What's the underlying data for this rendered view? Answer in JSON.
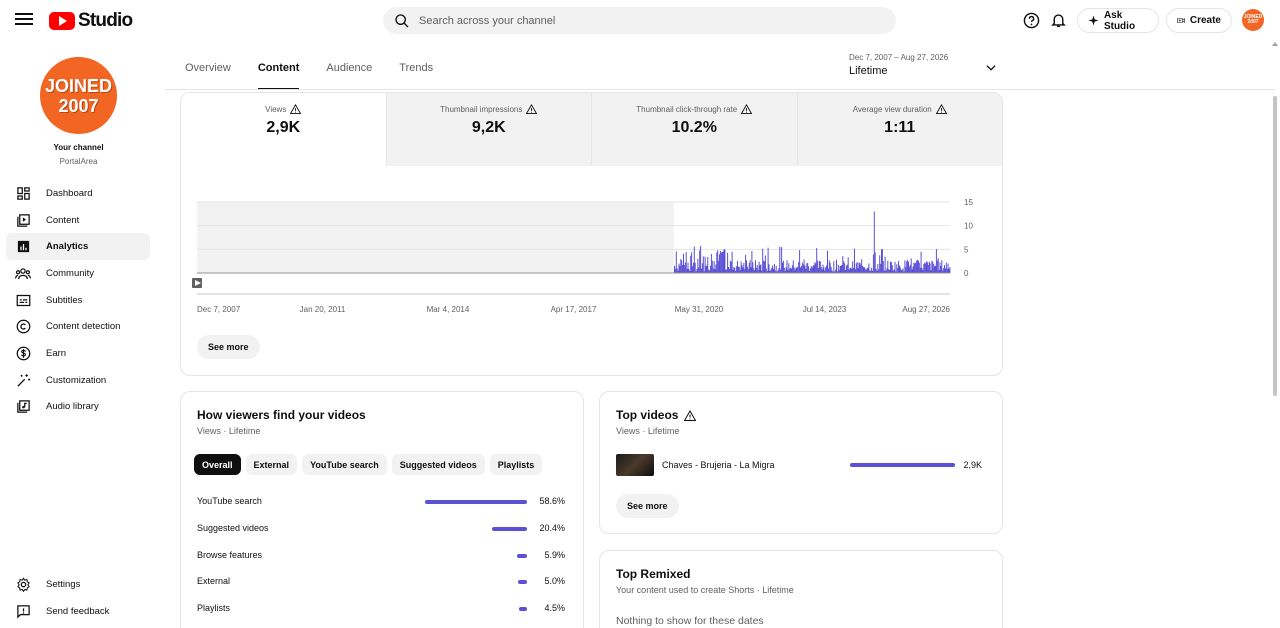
{
  "header": {
    "logo_text": "Studio",
    "search_placeholder": "Search across your channel",
    "ask_label": "Ask Studio",
    "create_label": "Create",
    "avatar_text_1": "JOINED",
    "avatar_text_2": "2007"
  },
  "sidebar": {
    "avatar_line1": "JOINED",
    "avatar_line2": "2007",
    "channel_label": "Your channel",
    "channel_name": "PortalArea",
    "items": [
      {
        "label": "Dashboard",
        "icon": "dashboard-icon"
      },
      {
        "label": "Content",
        "icon": "content-icon"
      },
      {
        "label": "Analytics",
        "icon": "analytics-icon",
        "active": true
      },
      {
        "label": "Community",
        "icon": "community-icon"
      },
      {
        "label": "Subtitles",
        "icon": "subtitles-icon"
      },
      {
        "label": "Content detection",
        "icon": "copyright-icon"
      },
      {
        "label": "Earn",
        "icon": "dollar-icon"
      },
      {
        "label": "Customization",
        "icon": "wand-icon"
      },
      {
        "label": "Audio library",
        "icon": "audio-library-icon"
      }
    ],
    "bottom": [
      {
        "label": "Settings",
        "icon": "gear-icon"
      },
      {
        "label": "Send feedback",
        "icon": "feedback-icon"
      }
    ]
  },
  "tabs": [
    "Overview",
    "Content",
    "Audience",
    "Trends"
  ],
  "active_tab": "Content",
  "date_range": {
    "dates": "Dec 7, 2007 – Aug 27, 2026",
    "label": "Lifetime"
  },
  "metrics": [
    {
      "label": "Views",
      "value": "2,9K"
    },
    {
      "label": "Thumbnail impressions",
      "value": "9,2K"
    },
    {
      "label": "Thumbnail click-through rate",
      "value": "10.2%"
    },
    {
      "label": "Average view duration",
      "value": "1:11"
    }
  ],
  "chart_data": {
    "type": "bar",
    "title": "",
    "xlabel": "",
    "ylabel": "",
    "x_ticks": [
      "Dec 7, 2007",
      "Jan 20, 2011",
      "Mar 4, 2014",
      "Apr 17, 2017",
      "May 31, 2020",
      "Jul 14, 2023",
      "Aug 27, 2026"
    ],
    "y_ticks": [
      15,
      10,
      5,
      0
    ],
    "ylim": [
      0,
      15
    ],
    "series": [
      {
        "x_range": [
          "Oct 2019",
          "Aug 27, 2026"
        ],
        "peak_date": "Oct 2024",
        "peak_value": 13,
        "typical_range": [
          0,
          5
        ]
      }
    ],
    "grid": true,
    "shaded_region": [
      "Dec 7, 2007",
      "Oct 2019"
    ],
    "color": "#5b50d6"
  },
  "main_see_more": "See more",
  "traffic": {
    "title": "How viewers find your videos",
    "subtitle": "Views · Lifetime",
    "chips": [
      "Overall",
      "External",
      "YouTube search",
      "Suggested videos",
      "Playlists"
    ],
    "rows": [
      {
        "label": "YouTube search",
        "value": "58.6%",
        "pct": 58.6
      },
      {
        "label": "Suggested videos",
        "value": "20.4%",
        "pct": 20.4
      },
      {
        "label": "Browse features",
        "value": "5.9%",
        "pct": 5.9
      },
      {
        "label": "External",
        "value": "5.0%",
        "pct": 5.0
      },
      {
        "label": "Playlists",
        "value": "4.5%",
        "pct": 4.5
      }
    ]
  },
  "top_videos": {
    "title": "Top videos",
    "subtitle": "Views · Lifetime",
    "videos": [
      {
        "title": "Chaves - Brujeria - La Migra",
        "value": "2,9K"
      }
    ],
    "see_more": "See more"
  },
  "top_remixed": {
    "title": "Top Remixed",
    "subtitle": "Your content used to create Shorts · Lifetime",
    "empty": "Nothing to show for these dates"
  }
}
